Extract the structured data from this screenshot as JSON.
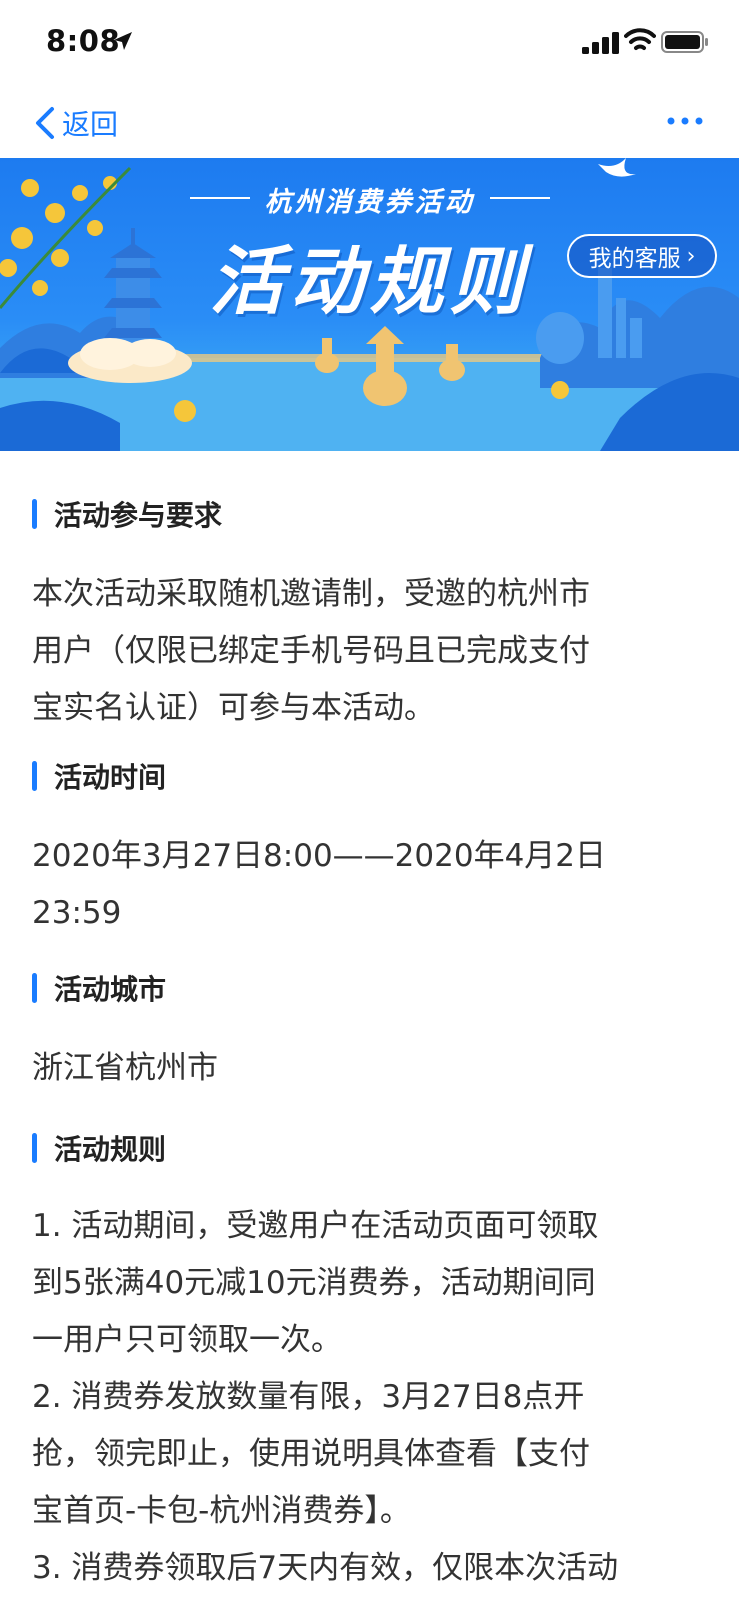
{
  "status_bar": {
    "time": "8:08"
  },
  "nav": {
    "back_label": "返回"
  },
  "banner": {
    "subtitle": "杭州消费券活动",
    "title": "活动规则",
    "service_label": "我的客服"
  },
  "sections": [
    {
      "title": "活动参与要求",
      "lines": [
        "本次活动采取随机邀请制，受邀的杭州市",
        "用户（仅限已绑定手机号码且已完成支付",
        "宝实名认证）可参与本活动。"
      ]
    },
    {
      "title": "活动时间",
      "lines": [
        "2020年3月27日8:00——2020年4月2日",
        "23:59"
      ]
    },
    {
      "title": "活动城市",
      "lines": [
        "浙江省杭州市"
      ]
    },
    {
      "title": "活动规则",
      "lines": [
        "1. 活动期间，受邀用户在活动页面可领取",
        "到5张满40元减10元消费券，活动期间同",
        "一用户只可领取一次。",
        "2. 消费券发放数量有限，3月27日8点开",
        "抢，领完即止，使用说明具体查看【支付",
        "宝首页-卡包-杭州消费券】。",
        "3. 消费券领取后7天内有效，仅限本次活动"
      ]
    }
  ],
  "colors": {
    "accent": "#1a7cff",
    "banner_bg": "#2a8df6"
  }
}
